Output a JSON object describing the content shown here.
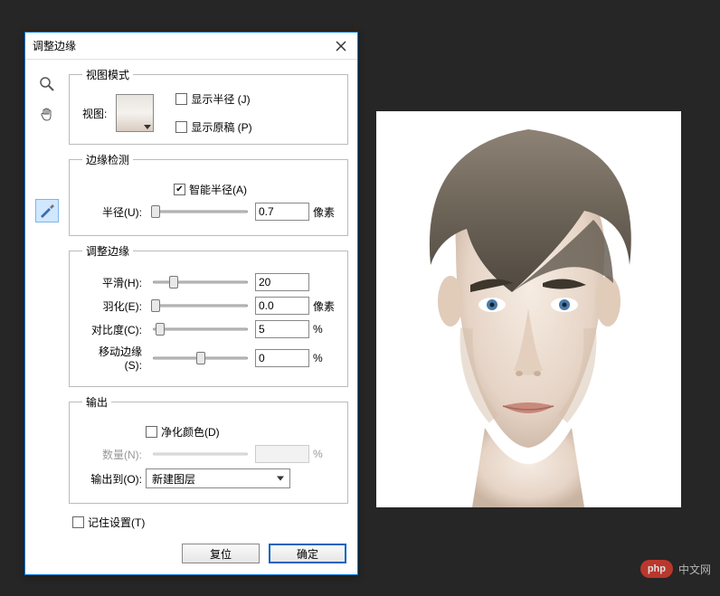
{
  "dialog": {
    "title": "调整边缘",
    "groups": {
      "view_mode": {
        "legend": "视图模式",
        "view_label": "视图:",
        "show_radius": {
          "label": "显示半径 (J)",
          "checked": false
        },
        "show_original": {
          "label": "显示原稿 (P)",
          "checked": false
        }
      },
      "edge_detection": {
        "legend": "边缘检测",
        "smart_radius": {
          "label": "智能半径(A)",
          "checked": true
        },
        "radius_label": "半径(U):",
        "radius_value": "0.7",
        "radius_unit": "像素"
      },
      "adjust_edge": {
        "legend": "调整边缘",
        "smooth_label": "平滑(H):",
        "smooth_value": "20",
        "feather_label": "羽化(E):",
        "feather_value": "0.0",
        "feather_unit": "像素",
        "contrast_label": "对比度(C):",
        "contrast_value": "5",
        "contrast_unit": "%",
        "shift_label": "移动边缘(S):",
        "shift_value": "0",
        "shift_unit": "%"
      },
      "output": {
        "legend": "输出",
        "decontaminate": {
          "label": "净化颜色(D)",
          "checked": false
        },
        "amount_label": "数量(N):",
        "amount_value": "",
        "amount_unit": "%",
        "output_to_label": "输出到(O):",
        "output_to_value": "新建图层"
      }
    },
    "remember": {
      "label": "记住设置(T)",
      "checked": false
    },
    "buttons": {
      "reset": "复位",
      "ok": "确定"
    }
  },
  "watermark": {
    "pill": "php",
    "text": "中文网"
  }
}
